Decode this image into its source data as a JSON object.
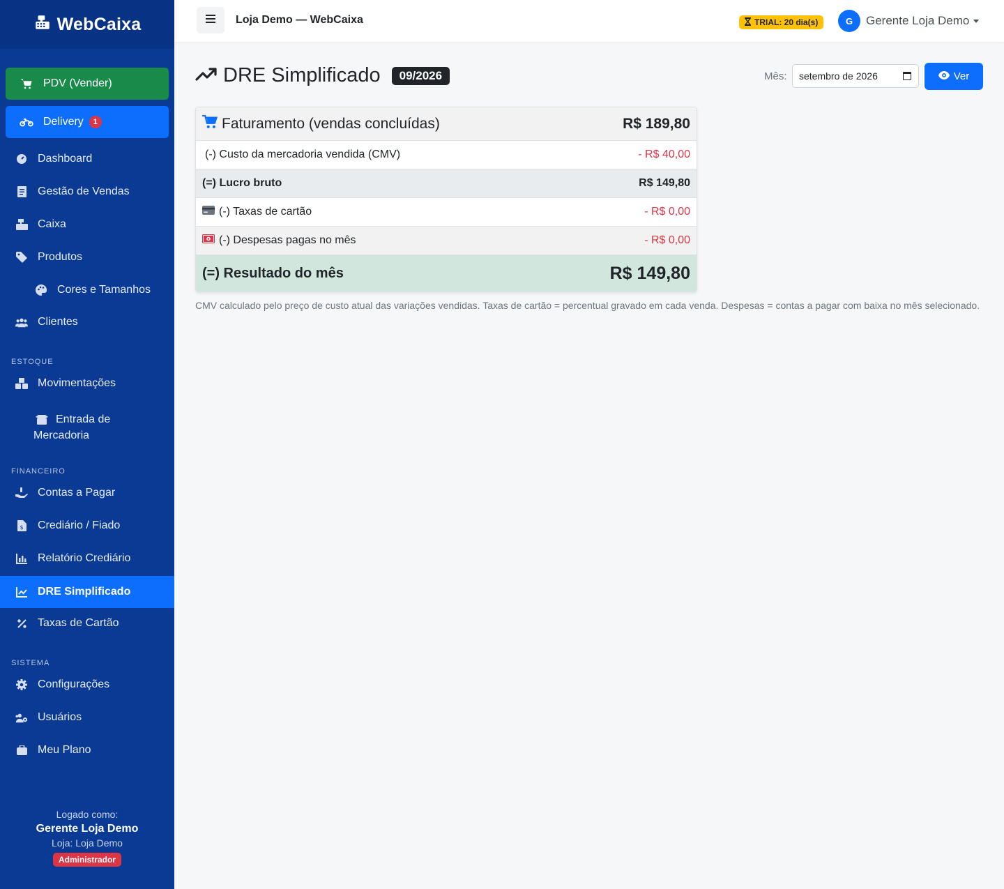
{
  "brand": {
    "name": "WebCaixa"
  },
  "sidebar": {
    "pdv_label": "PDV (Vender)",
    "delivery_label": "Delivery",
    "delivery_count": "1",
    "items": {
      "dashboard": "Dashboard",
      "vendas": "Gestão de Vendas",
      "caixa": "Caixa",
      "produtos": "Produtos",
      "cores": "Cores e Tamanhos",
      "clientes": "Clientes",
      "movimentacoes": "Movimentações",
      "entrada": "Entrada de Mercadoria",
      "contas": "Contas a Pagar",
      "crediario": "Crediário / Fiado",
      "relatorio": "Relatório Crediário",
      "dre": "DRE Simplificado",
      "taxas": "Taxas de Cartão",
      "config": "Configurações",
      "usuarios": "Usuários",
      "plano": "Meu Plano"
    },
    "sections": {
      "estoque": "ESTOQUE",
      "financeiro": "FINANCEIRO",
      "sistema": "SISTEMA"
    },
    "footer": {
      "logged_as": "Logado como:",
      "user": "Gerente Loja Demo",
      "store": "Loja: Loja Demo",
      "role": "Administrador"
    }
  },
  "topbar": {
    "store_title": "Loja Demo — WebCaixa",
    "trial": "TRIAL: 20 dia(s)",
    "avatar_initial": "G",
    "user_name": "Gerente Loja Demo"
  },
  "main": {
    "title": "DRE Simplificado",
    "period": "09/2026",
    "month_label": "Mês:",
    "month_value": "setembro de 2026",
    "view_button": "Ver",
    "rows": {
      "faturamento_label": "Faturamento (vendas concluídas)",
      "faturamento_value": "R$ 189,80",
      "cmv_label": "(-) Custo da mercadoria vendida (CMV)",
      "cmv_value": "- R$ 40,00",
      "lucro_label": "(=) Lucro bruto",
      "lucro_value": "R$ 149,80",
      "taxas_label": "(-) Taxas de cartão",
      "taxas_value": "- R$ 0,00",
      "despesas_label": "(-) Despesas pagas no mês",
      "despesas_value": "- R$ 0,00",
      "resultado_label": "(=) Resultado do mês",
      "resultado_value": "R$ 149,80"
    },
    "note": "CMV calculado pelo preço de custo atual das variações vendidas. Taxas de cartão = percentual gravado em cada venda. Despesas = contas a pagar com baixa no mês selecionado."
  },
  "colors": {
    "sidebar_bg": "#0a3a94",
    "accent": "#0d6efd",
    "pdv_green": "#198a4a",
    "negative": "#dc3545",
    "result_bg": "#d1e7dd",
    "trial_yellow": "#ffc107"
  }
}
